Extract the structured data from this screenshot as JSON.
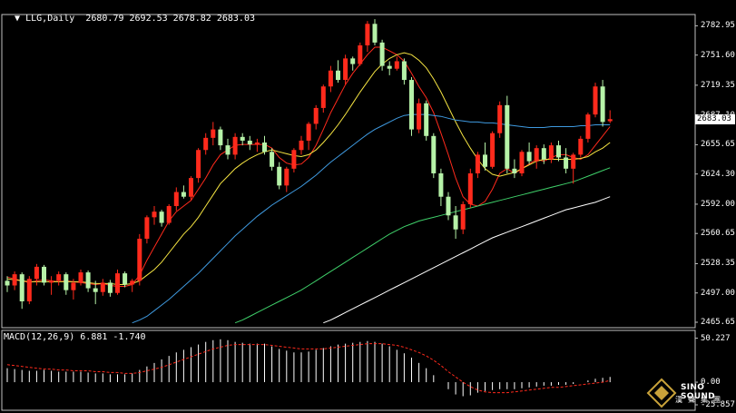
{
  "header": {
    "symbol": "LLG,Daily",
    "ohlc": "2680.79 2692.53 2678.82 2683.03",
    "macd_label": "MACD(12,26,9) 6.881 -1.740"
  },
  "price_axis": [
    "2782.95",
    "2751.60",
    "2719.35",
    "2687.10",
    "2655.65",
    "2624.30",
    "2592.00",
    "2560.65",
    "2528.35",
    "2497.00",
    "2465.65"
  ],
  "price_badge": "2683.03",
  "macd_axis": [
    "50.227",
    "0.00",
    "-25.857"
  ],
  "logo": {
    "en": "SINO SOUND",
    "cn": "漢聲集團"
  },
  "colors": {
    "bg": "#000000",
    "up": "#ff2a1c",
    "down": "#b6f2a8",
    "ma5": "#ff2a1c",
    "ma10": "#f5e442",
    "ma30": "#3f9ae0",
    "ma60": "#3fd06a",
    "ma120": "#ffffff",
    "macd_hist": "#ffffff",
    "signal": "#ff2a1c",
    "grid": "#c0c0c0"
  },
  "chart_data": {
    "type": "candlestick",
    "title": "LLG,Daily",
    "ylim": [
      2465.65,
      2795
    ],
    "yticks": [
      2782.95,
      2751.6,
      2719.35,
      2687.1,
      2655.65,
      2624.3,
      2592.0,
      2560.65,
      2528.35,
      2497.0,
      2465.65
    ],
    "candles": [
      [
        2510,
        2515,
        2498,
        2505
      ],
      [
        2505,
        2520,
        2500,
        2517
      ],
      [
        2517,
        2519,
        2480,
        2488
      ],
      [
        2488,
        2515,
        2485,
        2512
      ],
      [
        2512,
        2528,
        2505,
        2525
      ],
      [
        2525,
        2527,
        2505,
        2508
      ],
      [
        2508,
        2515,
        2495,
        2510
      ],
      [
        2510,
        2520,
        2505,
        2517
      ],
      [
        2517,
        2519,
        2495,
        2500
      ],
      [
        2500,
        2512,
        2490,
        2508
      ],
      [
        2508,
        2522,
        2505,
        2519
      ],
      [
        2519,
        2521,
        2498,
        2502
      ],
      [
        2502,
        2510,
        2485,
        2498
      ],
      [
        2498,
        2512,
        2494,
        2508
      ],
      [
        2508,
        2511,
        2493,
        2497
      ],
      [
        2497,
        2522,
        2495,
        2518
      ],
      [
        2518,
        2520,
        2503,
        2506
      ],
      [
        2506,
        2512,
        2498,
        2510
      ],
      [
        2510,
        2560,
        2505,
        2555
      ],
      [
        2555,
        2580,
        2550,
        2578
      ],
      [
        2578,
        2590,
        2570,
        2584
      ],
      [
        2584,
        2586,
        2568,
        2572
      ],
      [
        2572,
        2592,
        2570,
        2590
      ],
      [
        2590,
        2610,
        2585,
        2605
      ],
      [
        2605,
        2612,
        2598,
        2600
      ],
      [
        2600,
        2622,
        2596,
        2620
      ],
      [
        2620,
        2652,
        2615,
        2650
      ],
      [
        2650,
        2668,
        2645,
        2663
      ],
      [
        2663,
        2680,
        2655,
        2672
      ],
      [
        2672,
        2675,
        2650,
        2655
      ],
      [
        2655,
        2662,
        2640,
        2645
      ],
      [
        2645,
        2668,
        2640,
        2664
      ],
      [
        2664,
        2668,
        2655,
        2660
      ],
      [
        2660,
        2665,
        2650,
        2656
      ],
      [
        2656,
        2662,
        2648,
        2658
      ],
      [
        2658,
        2665,
        2645,
        2648
      ],
      [
        2648,
        2652,
        2628,
        2632
      ],
      [
        2632,
        2637,
        2608,
        2612
      ],
      [
        2612,
        2632,
        2605,
        2630
      ],
      [
        2630,
        2652,
        2626,
        2650
      ],
      [
        2650,
        2665,
        2645,
        2660
      ],
      [
        2660,
        2680,
        2650,
        2678
      ],
      [
        2678,
        2698,
        2672,
        2695
      ],
      [
        2695,
        2720,
        2690,
        2718
      ],
      [
        2718,
        2740,
        2712,
        2735
      ],
      [
        2735,
        2746,
        2722,
        2725
      ],
      [
        2725,
        2752,
        2720,
        2748
      ],
      [
        2748,
        2750,
        2735,
        2742
      ],
      [
        2742,
        2765,
        2740,
        2762
      ],
      [
        2762,
        2788,
        2755,
        2785
      ],
      [
        2785,
        2790,
        2762,
        2765
      ],
      [
        2765,
        2768,
        2735,
        2740
      ],
      [
        2740,
        2745,
        2730,
        2737
      ],
      [
        2737,
        2750,
        2735,
        2745
      ],
      [
        2745,
        2748,
        2720,
        2725
      ],
      [
        2725,
        2728,
        2665,
        2672
      ],
      [
        2672,
        2705,
        2668,
        2700
      ],
      [
        2700,
        2703,
        2660,
        2665
      ],
      [
        2665,
        2668,
        2620,
        2625
      ],
      [
        2625,
        2630,
        2590,
        2600
      ],
      [
        2600,
        2605,
        2575,
        2580
      ],
      [
        2580,
        2590,
        2555,
        2565
      ],
      [
        2565,
        2595,
        2560,
        2592
      ],
      [
        2592,
        2630,
        2588,
        2625
      ],
      [
        2625,
        2648,
        2620,
        2645
      ],
      [
        2645,
        2658,
        2628,
        2632
      ],
      [
        2632,
        2670,
        2630,
        2668
      ],
      [
        2668,
        2702,
        2663,
        2698
      ],
      [
        2698,
        2708,
        2625,
        2630
      ],
      [
        2630,
        2640,
        2620,
        2625
      ],
      [
        2625,
        2650,
        2622,
        2648
      ],
      [
        2648,
        2658,
        2635,
        2638
      ],
      [
        2638,
        2655,
        2630,
        2652
      ],
      [
        2652,
        2656,
        2635,
        2640
      ],
      [
        2640,
        2658,
        2636,
        2655
      ],
      [
        2655,
        2660,
        2638,
        2642
      ],
      [
        2642,
        2652,
        2625,
        2630
      ],
      [
        2630,
        2647,
        2614,
        2645
      ],
      [
        2645,
        2665,
        2642,
        2662
      ],
      [
        2662,
        2690,
        2658,
        2688
      ],
      [
        2688,
        2722,
        2685,
        2718
      ],
      [
        2718,
        2725,
        2675,
        2680
      ],
      [
        2680.79,
        2692.53,
        2678.82,
        2683.03
      ]
    ],
    "ma_series": [
      {
        "values_role": "ma5",
        "values": [
          2514,
          2512,
          2510,
          2508,
          2510,
          2511,
          2510,
          2509,
          2510,
          2509,
          2508,
          2507,
          2506,
          2507,
          2505,
          2504,
          2504,
          2506,
          2516,
          2532,
          2546,
          2560,
          2574,
          2584,
          2590,
          2596,
          2608,
          2620,
          2634,
          2645,
          2650,
          2655,
          2656,
          2656,
          2656,
          2656,
          2652,
          2642,
          2636,
          2634,
          2635,
          2642,
          2655,
          2672,
          2690,
          2705,
          2720,
          2732,
          2742,
          2752,
          2760,
          2760,
          2756,
          2752,
          2745,
          2732,
          2718,
          2706,
          2690,
          2668,
          2645,
          2620,
          2600,
          2592,
          2590,
          2595,
          2608,
          2625,
          2630,
          2625,
          2630,
          2635,
          2640,
          2638,
          2642,
          2645,
          2645,
          2642,
          2640,
          2645,
          2655,
          2665,
          2675
        ]
      },
      {
        "values_role": "ma10",
        "values": [
          2512,
          2511,
          2510,
          2509,
          2509,
          2509,
          2509,
          2509,
          2509,
          2509,
          2509,
          2508,
          2507,
          2507,
          2507,
          2506,
          2506,
          2507,
          2510,
          2516,
          2522,
          2530,
          2540,
          2550,
          2560,
          2568,
          2578,
          2590,
          2602,
          2614,
          2622,
          2630,
          2636,
          2641,
          2645,
          2648,
          2650,
          2648,
          2646,
          2644,
          2643,
          2645,
          2650,
          2658,
          2667,
          2677,
          2688,
          2700,
          2712,
          2723,
          2734,
          2742,
          2748,
          2752,
          2754,
          2752,
          2746,
          2738,
          2726,
          2712,
          2696,
          2680,
          2665,
          2652,
          2640,
          2630,
          2624,
          2622,
          2624,
          2626,
          2630,
          2634,
          2638,
          2640,
          2640,
          2640,
          2640,
          2640,
          2641,
          2643,
          2648,
          2652,
          2658
        ]
      },
      {
        "values_role": "ma30",
        "values": [
          null,
          null,
          null,
          null,
          null,
          null,
          null,
          null,
          null,
          null,
          null,
          null,
          null,
          null,
          null,
          null,
          null,
          2465,
          2468,
          2472,
          2478,
          2484,
          2490,
          2497,
          2504,
          2511,
          2518,
          2526,
          2534,
          2542,
          2550,
          2558,
          2565,
          2572,
          2579,
          2585,
          2591,
          2596,
          2601,
          2606,
          2611,
          2617,
          2623,
          2630,
          2637,
          2643,
          2649,
          2655,
          2661,
          2667,
          2672,
          2676,
          2680,
          2684,
          2687,
          2688,
          2688,
          2688,
          2687,
          2686,
          2684,
          2682,
          2681,
          2680,
          2680,
          2679,
          2679,
          2678,
          2677,
          2676,
          2675,
          2674,
          2674,
          2674,
          2675,
          2675,
          2675,
          2675,
          2676,
          2676,
          2677,
          2677,
          2677
        ]
      },
      {
        "values_role": "ma60",
        "values": [
          null,
          null,
          null,
          null,
          null,
          null,
          null,
          null,
          null,
          null,
          null,
          null,
          null,
          null,
          null,
          null,
          null,
          null,
          null,
          null,
          null,
          null,
          null,
          null,
          null,
          null,
          null,
          null,
          null,
          null,
          null,
          2465,
          2468,
          2472,
          2476,
          2480,
          2484,
          2488,
          2492,
          2496,
          2500,
          2505,
          2510,
          2515,
          2520,
          2525,
          2530,
          2535,
          2540,
          2545,
          2550,
          2555,
          2560,
          2564,
          2568,
          2571,
          2574,
          2576,
          2578,
          2580,
          2582,
          2584,
          2586,
          2588,
          2590,
          2592,
          2594,
          2596,
          2598,
          2600,
          2602,
          2604,
          2606,
          2608,
          2610,
          2612,
          2614,
          2616,
          2619,
          2622,
          2625,
          2628,
          2631
        ]
      },
      {
        "values_role": "ma120",
        "values": [
          null,
          null,
          null,
          null,
          null,
          null,
          null,
          null,
          null,
          null,
          null,
          null,
          null,
          null,
          null,
          null,
          null,
          null,
          null,
          null,
          null,
          null,
          null,
          null,
          null,
          null,
          null,
          null,
          null,
          null,
          null,
          null,
          null,
          null,
          null,
          null,
          null,
          null,
          null,
          null,
          null,
          null,
          null,
          2465,
          2468,
          2472,
          2476,
          2480,
          2484,
          2488,
          2492,
          2496,
          2500,
          2504,
          2508,
          2512,
          2516,
          2520,
          2524,
          2528,
          2532,
          2536,
          2540,
          2544,
          2548,
          2552,
          2556,
          2559,
          2562,
          2565,
          2568,
          2571,
          2574,
          2577,
          2580,
          2583,
          2586,
          2588,
          2590,
          2592,
          2594,
          2597,
          2600
        ]
      }
    ],
    "macd": {
      "ylim": [
        -30,
        55
      ],
      "hist": [
        16,
        15,
        14,
        13,
        13,
        14,
        13,
        12,
        12,
        12,
        12,
        11,
        10,
        10,
        9,
        9,
        9,
        10,
        14,
        18,
        22,
        26,
        30,
        34,
        37,
        40,
        43,
        46,
        48,
        49,
        48,
        46,
        45,
        44,
        44,
        44,
        41,
        38,
        36,
        34,
        34,
        35,
        37,
        39,
        41,
        43,
        44,
        45,
        46,
        47,
        46,
        44,
        41,
        37,
        33,
        28,
        22,
        16,
        8,
        0,
        -8,
        -14,
        -16,
        -15,
        -12,
        -10,
        -9,
        -8,
        -8,
        -8,
        -7,
        -6,
        -5,
        -4,
        -4,
        -3,
        -3,
        -2,
        0,
        2,
        4,
        5,
        6
      ],
      "signal": [
        20,
        19,
        18,
        17,
        16,
        15,
        15,
        14,
        14,
        13,
        13,
        13,
        12,
        12,
        11,
        11,
        10,
        10,
        11,
        13,
        15,
        17,
        20,
        23,
        26,
        29,
        32,
        35,
        38,
        40,
        42,
        43,
        43,
        43,
        43,
        43,
        42,
        41,
        40,
        39,
        38,
        38,
        38,
        38,
        39,
        40,
        41,
        42,
        43,
        44,
        44,
        44,
        43,
        42,
        40,
        37,
        34,
        30,
        25,
        19,
        12,
        6,
        0,
        -5,
        -9,
        -11,
        -12,
        -12,
        -12,
        -11,
        -10,
        -9,
        -8,
        -7,
        -6,
        -6,
        -5,
        -4,
        -3,
        -2,
        -1,
        0,
        2
      ]
    }
  }
}
